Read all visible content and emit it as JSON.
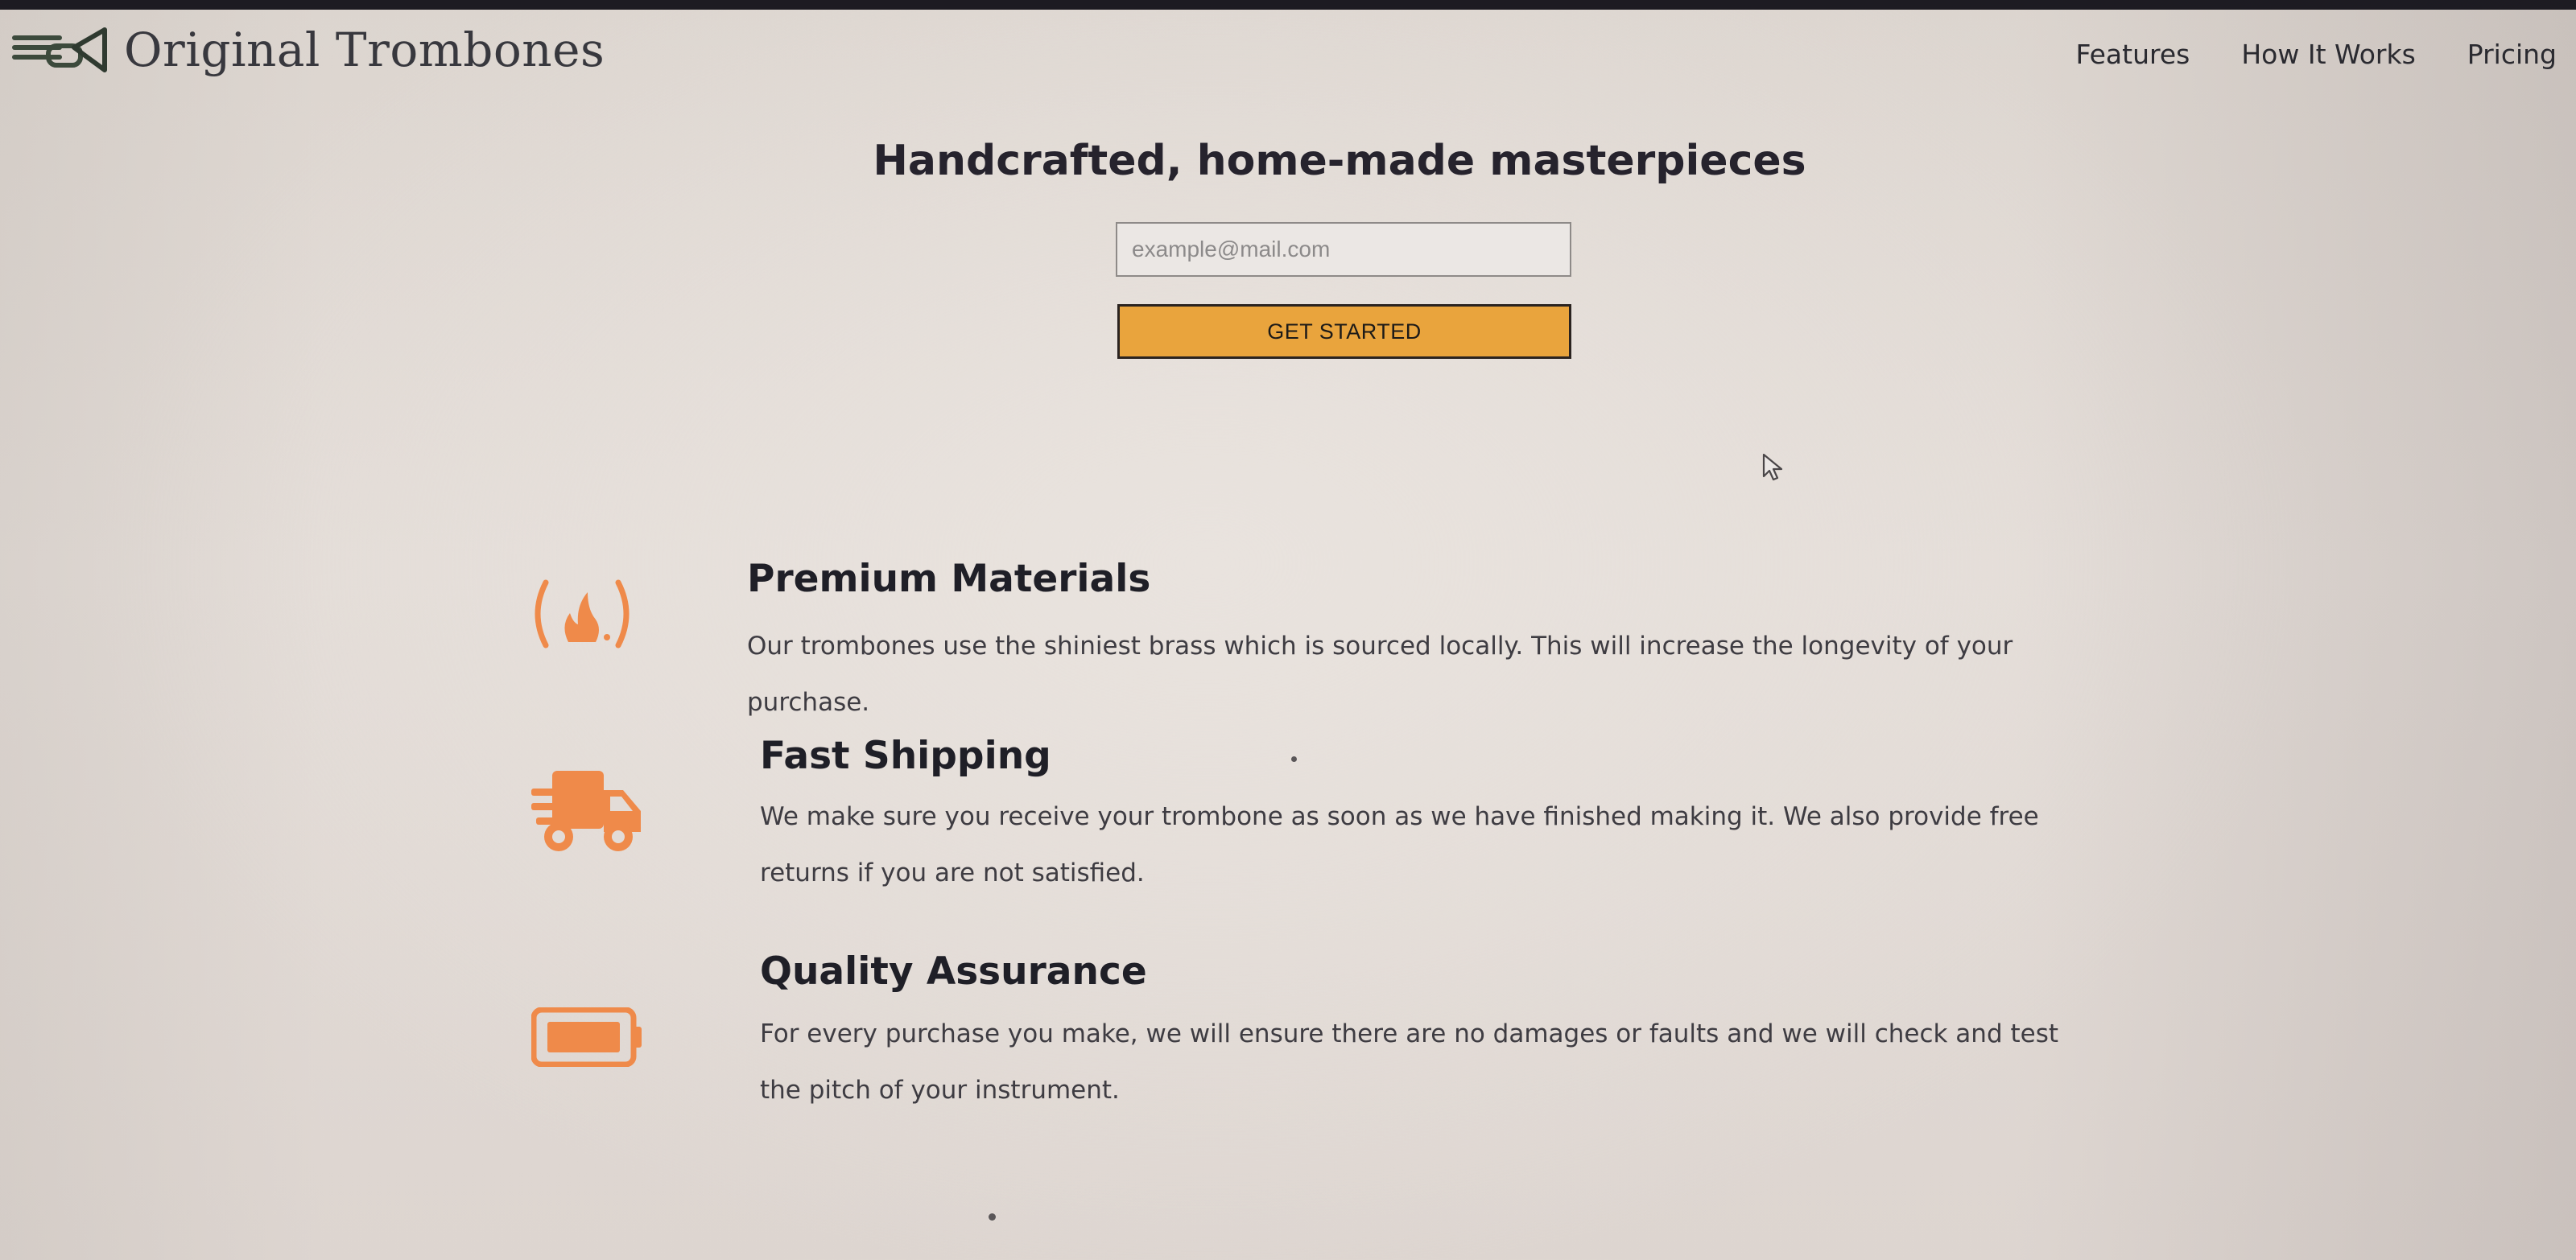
{
  "header": {
    "logo_text": "Original Trombones",
    "nav": [
      {
        "label": "Features"
      },
      {
        "label": "How It Works"
      },
      {
        "label": "Pricing"
      }
    ]
  },
  "hero": {
    "title": "Handcrafted, home-made masterpieces",
    "email_placeholder": "example@mail.com",
    "cta_label": "GET STARTED"
  },
  "features": [
    {
      "icon": "fire-icon",
      "title": "Premium Materials",
      "description": "Our trombones use the shiniest brass which is sourced locally. This will increase the longevity of your purchase."
    },
    {
      "icon": "truck-icon",
      "title": "Fast Shipping",
      "description": "We make sure you receive your trombone as soon as we have finished making it. We also provide free returns if you are not satisfied."
    },
    {
      "icon": "battery-icon",
      "title": "Quality Assurance",
      "description": "For every purchase you make, we will ensure there are no damages or faults and we will check and test the pitch of your instrument."
    }
  ],
  "colors": {
    "accent_orange": "#ef8a4a",
    "button_yellow": "#e9a43d",
    "background": "#e3dcd7"
  }
}
